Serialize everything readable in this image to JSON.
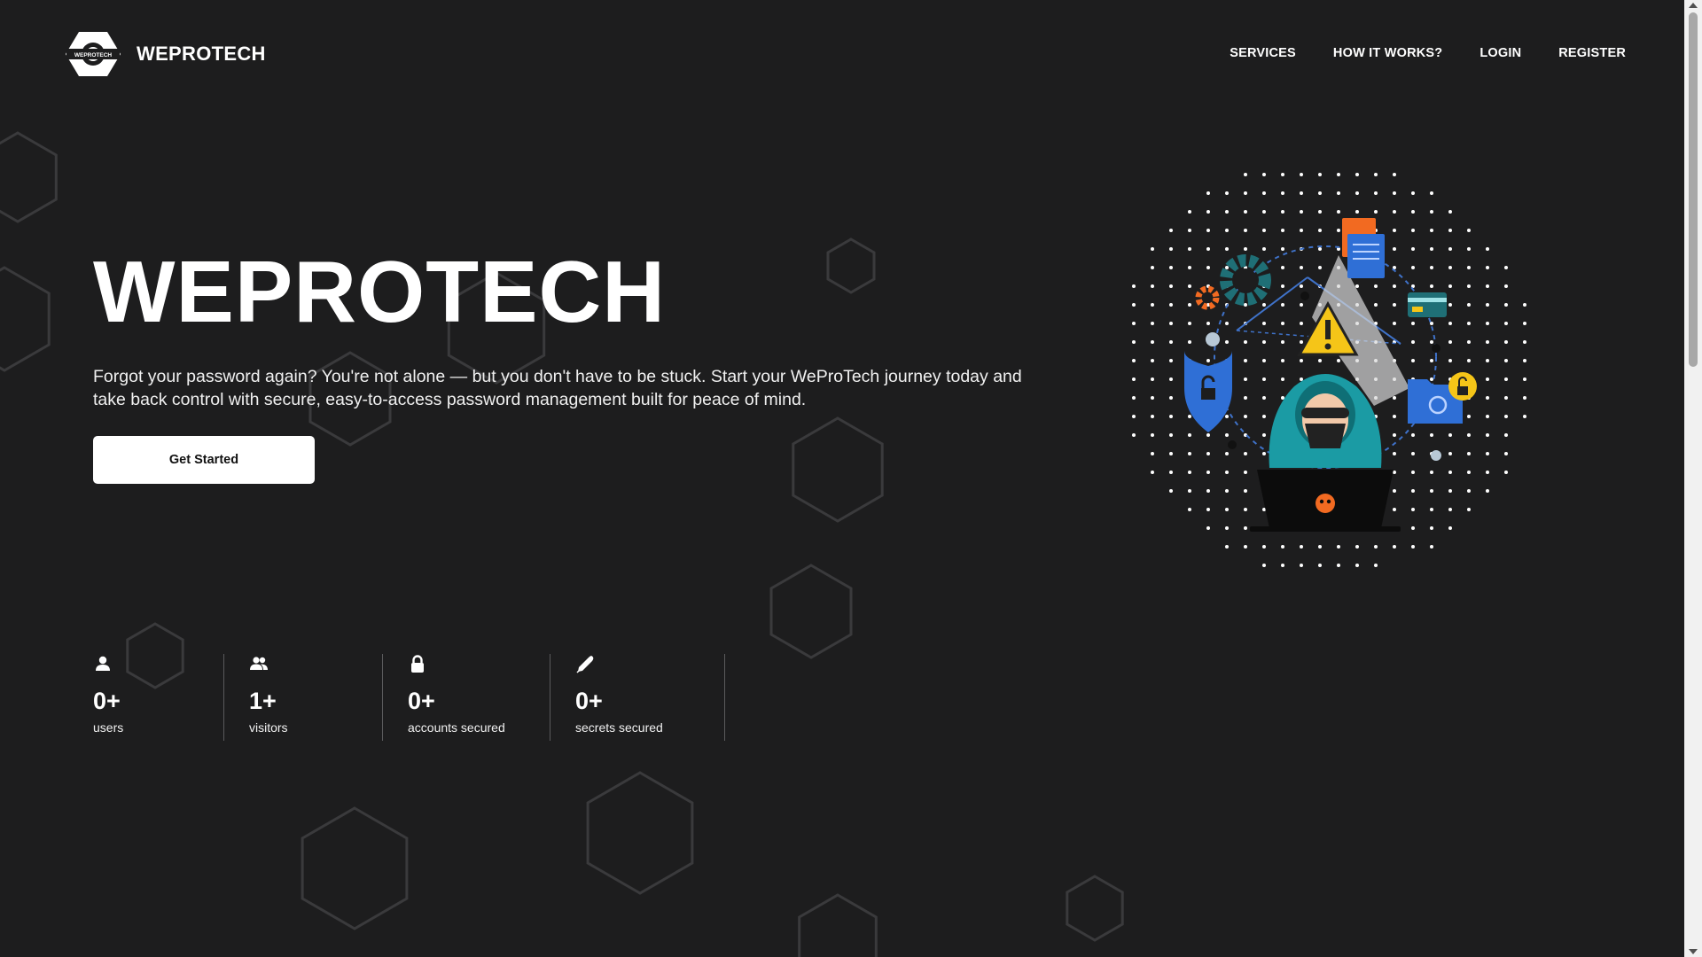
{
  "header": {
    "brand": "WEPROTECH",
    "logo_text": "WEPROTECH",
    "nav": [
      "SERVICES",
      "HOW IT WORKS?",
      "LOGIN",
      "REGISTER"
    ]
  },
  "hero": {
    "title": "WEPROTECH",
    "description": "Forgot your password again? You're not alone — but you don't have to be stuck. Start your WeProTech journey today and take back control with secure, easy-to-access password management built for peace of mind.",
    "cta_label": "Get Started"
  },
  "stats": [
    {
      "icon": "user-icon",
      "value": "0+",
      "label": "users"
    },
    {
      "icon": "users-icon",
      "value": "1+",
      "label": "visitors"
    },
    {
      "icon": "lock-icon",
      "value": "0+",
      "label": "accounts secured"
    },
    {
      "icon": "pen-icon",
      "value": "0+",
      "label": "secrets secured"
    }
  ],
  "colors": {
    "background": "#1d1d1e",
    "text": "#ffffff",
    "button_bg": "#ffffff",
    "teal": "#1f6f76",
    "orange": "#f26a21",
    "blue": "#2f6fd6",
    "yellow": "#f5c518"
  }
}
